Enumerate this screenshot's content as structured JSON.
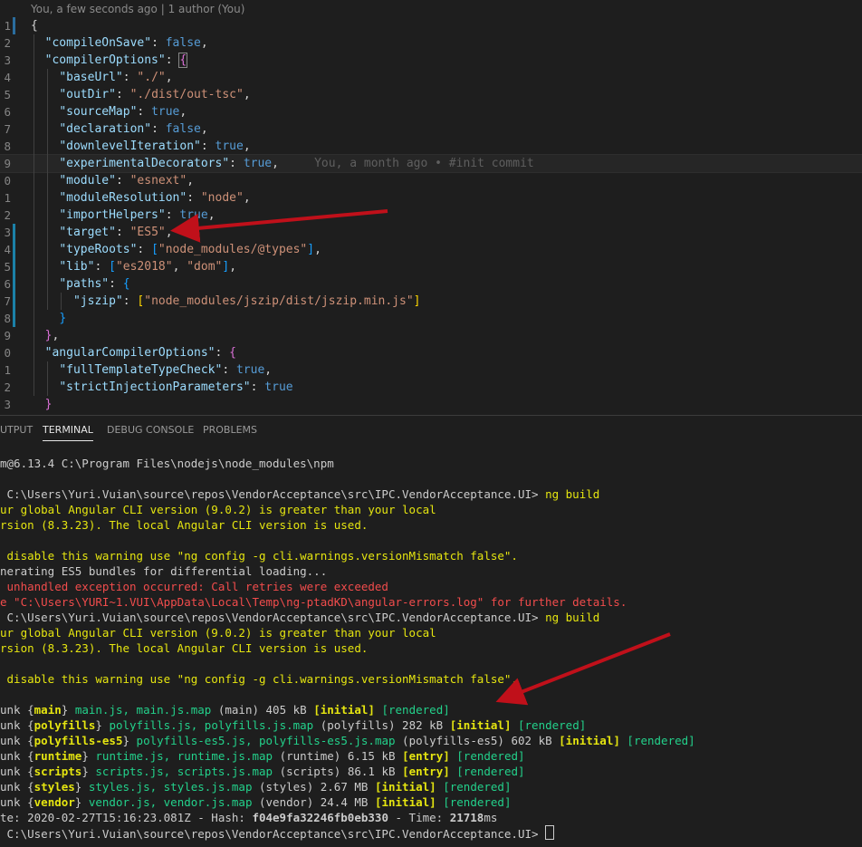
{
  "editor": {
    "blame_header": "You, a few seconds ago | 1 author (You)",
    "inline_blame": "You, a month ago • #init commit",
    "lines": [
      {
        "n": "1",
        "segs": [
          [
            "p",
            "{"
          ]
        ]
      },
      {
        "n": "2",
        "segs": [
          [
            "p",
            "  "
          ],
          [
            "k",
            "\"compileOnSave\""
          ],
          [
            "p",
            ": "
          ],
          [
            "b",
            "false"
          ],
          [
            "p",
            ","
          ]
        ]
      },
      {
        "n": "3",
        "segs": [
          [
            "p",
            "  "
          ],
          [
            "k",
            "\"compilerOptions\""
          ],
          [
            "p",
            ": "
          ],
          [
            "br2",
            "{"
          ]
        ]
      },
      {
        "n": "4",
        "segs": [
          [
            "p",
            "    "
          ],
          [
            "k",
            "\"baseUrl\""
          ],
          [
            "p",
            ": "
          ],
          [
            "s",
            "\"./\""
          ],
          [
            "p",
            ","
          ]
        ]
      },
      {
        "n": "5",
        "segs": [
          [
            "p",
            "    "
          ],
          [
            "k",
            "\"outDir\""
          ],
          [
            "p",
            ": "
          ],
          [
            "s",
            "\"./dist/out-tsc\""
          ],
          [
            "p",
            ","
          ]
        ]
      },
      {
        "n": "6",
        "segs": [
          [
            "p",
            "    "
          ],
          [
            "k",
            "\"sourceMap\""
          ],
          [
            "p",
            ": "
          ],
          [
            "b",
            "true"
          ],
          [
            "p",
            ","
          ]
        ]
      },
      {
        "n": "7",
        "segs": [
          [
            "p",
            "    "
          ],
          [
            "k",
            "\"declaration\""
          ],
          [
            "p",
            ": "
          ],
          [
            "b",
            "false"
          ],
          [
            "p",
            ","
          ]
        ]
      },
      {
        "n": "8",
        "segs": [
          [
            "p",
            "    "
          ],
          [
            "k",
            "\"downlevelIteration\""
          ],
          [
            "p",
            ": "
          ],
          [
            "b",
            "true"
          ],
          [
            "p",
            ","
          ]
        ]
      },
      {
        "n": "9",
        "segs": [
          [
            "p",
            "    "
          ],
          [
            "k",
            "\"experimentalDecorators\""
          ],
          [
            "p",
            ": "
          ],
          [
            "b",
            "true"
          ],
          [
            "p",
            ","
          ]
        ]
      },
      {
        "n": "0",
        "segs": [
          [
            "p",
            "    "
          ],
          [
            "k",
            "\"module\""
          ],
          [
            "p",
            ": "
          ],
          [
            "s",
            "\"esnext\""
          ],
          [
            "p",
            ","
          ]
        ]
      },
      {
        "n": "1",
        "segs": [
          [
            "p",
            "    "
          ],
          [
            "k",
            "\"moduleResolution\""
          ],
          [
            "p",
            ": "
          ],
          [
            "s",
            "\"node\""
          ],
          [
            "p",
            ","
          ]
        ]
      },
      {
        "n": "2",
        "segs": [
          [
            "p",
            "    "
          ],
          [
            "k",
            "\"importHelpers\""
          ],
          [
            "p",
            ": "
          ],
          [
            "b",
            "true"
          ],
          [
            "p",
            ","
          ]
        ]
      },
      {
        "n": "3",
        "segs": [
          [
            "p",
            "    "
          ],
          [
            "k",
            "\"target\""
          ],
          [
            "p",
            ": "
          ],
          [
            "s",
            "\"ES5\""
          ],
          [
            "p",
            ","
          ]
        ]
      },
      {
        "n": "4",
        "segs": [
          [
            "p",
            "    "
          ],
          [
            "k",
            "\"typeRoots\""
          ],
          [
            "p",
            ": "
          ],
          [
            "br3",
            "["
          ],
          [
            "s",
            "\"node_modules/@types\""
          ],
          [
            "br3",
            "]"
          ],
          [
            "p",
            ","
          ]
        ]
      },
      {
        "n": "5",
        "segs": [
          [
            "p",
            "    "
          ],
          [
            "k",
            "\"lib\""
          ],
          [
            "p",
            ": "
          ],
          [
            "br3",
            "["
          ],
          [
            "s",
            "\"es2018\""
          ],
          [
            "p",
            ", "
          ],
          [
            "s",
            "\"dom\""
          ],
          [
            "br3",
            "]"
          ],
          [
            "p",
            ","
          ]
        ]
      },
      {
        "n": "6",
        "segs": [
          [
            "p",
            "    "
          ],
          [
            "k",
            "\"paths\""
          ],
          [
            "p",
            ": "
          ],
          [
            "br3",
            "{"
          ]
        ]
      },
      {
        "n": "7",
        "segs": [
          [
            "p",
            "      "
          ],
          [
            "k",
            "\"jszip\""
          ],
          [
            "p",
            ": "
          ],
          [
            "br1",
            "["
          ],
          [
            "s",
            "\"node_modules/jszip/dist/jszip.min.js\""
          ],
          [
            "br1",
            "]"
          ]
        ]
      },
      {
        "n": "8",
        "segs": [
          [
            "p",
            "    "
          ],
          [
            "br3",
            "}"
          ]
        ]
      },
      {
        "n": "9",
        "segs": [
          [
            "p",
            "  "
          ],
          [
            "br2",
            "}"
          ],
          [
            "p",
            ","
          ]
        ]
      },
      {
        "n": "0",
        "segs": [
          [
            "p",
            "  "
          ],
          [
            "k",
            "\"angularCompilerOptions\""
          ],
          [
            "p",
            ": "
          ],
          [
            "br2",
            "{"
          ]
        ]
      },
      {
        "n": "1",
        "segs": [
          [
            "p",
            "    "
          ],
          [
            "k",
            "\"fullTemplateTypeCheck\""
          ],
          [
            "p",
            ": "
          ],
          [
            "b",
            "true"
          ],
          [
            "p",
            ","
          ]
        ]
      },
      {
        "n": "2",
        "segs": [
          [
            "p",
            "    "
          ],
          [
            "k",
            "\"strictInjectionParameters\""
          ],
          [
            "p",
            ": "
          ],
          [
            "b",
            "true"
          ]
        ]
      },
      {
        "n": "3",
        "segs": [
          [
            "p",
            "  "
          ],
          [
            "br2",
            "}"
          ]
        ]
      }
    ]
  },
  "panel": {
    "tabs": [
      "UTPUT",
      "TERMINAL",
      "DEBUG CONSOLE",
      "PROBLEMS"
    ],
    "active_tab": "TERMINAL",
    "terminal_lines": [
      [
        [
          "t-w",
          "m@6.13.4 C:\\Program Files\\nodejs\\node_modules\\npm"
        ]
      ],
      [
        [
          "t-w",
          ""
        ]
      ],
      [
        [
          "t-w",
          " C:\\Users\\Yuri.Vuian\\source\\repos\\VendorAcceptance\\src\\IPC.VendorAcceptance.UI> "
        ],
        [
          "t-y",
          "ng build"
        ]
      ],
      [
        [
          "t-y",
          "ur global Angular CLI version (9.0.2) is greater than your local"
        ]
      ],
      [
        [
          "t-y",
          "rsion (8.3.23). The local Angular CLI version is used."
        ]
      ],
      [
        [
          "t-w",
          ""
        ]
      ],
      [
        [
          "t-y",
          " disable this warning use \"ng config -g cli.warnings.versionMismatch false\"."
        ]
      ],
      [
        [
          "t-w",
          "nerating ES5 bundles for differential loading..."
        ]
      ],
      [
        [
          "t-r",
          " unhandled exception occurred: Call retries were exceeded"
        ]
      ],
      [
        [
          "t-r",
          "e \"C:\\Users\\YURI~1.VUI\\AppData\\Local\\Temp\\ng-ptadKD\\angular-errors.log\" for further details."
        ]
      ],
      [
        [
          "t-w",
          " C:\\Users\\Yuri.Vuian\\source\\repos\\VendorAcceptance\\src\\IPC.VendorAcceptance.UI> "
        ],
        [
          "t-y",
          "ng build"
        ]
      ],
      [
        [
          "t-y",
          "ur global Angular CLI version (9.0.2) is greater than your local"
        ]
      ],
      [
        [
          "t-y",
          "rsion (8.3.23). The local Angular CLI version is used."
        ]
      ],
      [
        [
          "t-w",
          ""
        ]
      ],
      [
        [
          "t-y",
          " disable this warning use \"ng config -g cli.warnings.versionMismatch false\"."
        ]
      ],
      [
        [
          "t-w",
          ""
        ]
      ],
      [
        [
          "t-w",
          "unk {"
        ],
        [
          "t-y t-bold",
          "main"
        ],
        [
          "t-w",
          "} "
        ],
        [
          "t-g",
          "main.js, main.js.map"
        ],
        [
          "t-w",
          " (main) 405 kB "
        ],
        [
          "t-y t-bold",
          "[initial]"
        ],
        [
          "t-w",
          " "
        ],
        [
          "t-g",
          "[rendered]"
        ]
      ],
      [
        [
          "t-w",
          "unk {"
        ],
        [
          "t-y t-bold",
          "polyfills"
        ],
        [
          "t-w",
          "} "
        ],
        [
          "t-g",
          "polyfills.js, polyfills.js.map"
        ],
        [
          "t-w",
          " (polyfills) 282 kB "
        ],
        [
          "t-y t-bold",
          "[initial]"
        ],
        [
          "t-w",
          " "
        ],
        [
          "t-g",
          "[rendered]"
        ]
      ],
      [
        [
          "t-w",
          "unk {"
        ],
        [
          "t-y t-bold",
          "polyfills-es5"
        ],
        [
          "t-w",
          "} "
        ],
        [
          "t-g",
          "polyfills-es5.js, polyfills-es5.js.map"
        ],
        [
          "t-w",
          " (polyfills-es5) 602 kB "
        ],
        [
          "t-y t-bold",
          "[initial]"
        ],
        [
          "t-w",
          " "
        ],
        [
          "t-g",
          "[rendered]"
        ]
      ],
      [
        [
          "t-w",
          "unk {"
        ],
        [
          "t-y t-bold",
          "runtime"
        ],
        [
          "t-w",
          "} "
        ],
        [
          "t-g",
          "runtime.js, runtime.js.map"
        ],
        [
          "t-w",
          " (runtime) 6.15 kB "
        ],
        [
          "t-y t-bold",
          "[entry]"
        ],
        [
          "t-w",
          " "
        ],
        [
          "t-g",
          "[rendered]"
        ]
      ],
      [
        [
          "t-w",
          "unk {"
        ],
        [
          "t-y t-bold",
          "scripts"
        ],
        [
          "t-w",
          "} "
        ],
        [
          "t-g",
          "scripts.js, scripts.js.map"
        ],
        [
          "t-w",
          " (scripts) 86.1 kB "
        ],
        [
          "t-y t-bold",
          "[entry]"
        ],
        [
          "t-w",
          " "
        ],
        [
          "t-g",
          "[rendered]"
        ]
      ],
      [
        [
          "t-w",
          "unk {"
        ],
        [
          "t-y t-bold",
          "styles"
        ],
        [
          "t-w",
          "} "
        ],
        [
          "t-g",
          "styles.js, styles.js.map"
        ],
        [
          "t-w",
          " (styles) 2.67 MB "
        ],
        [
          "t-y t-bold",
          "[initial]"
        ],
        [
          "t-w",
          " "
        ],
        [
          "t-g",
          "[rendered]"
        ]
      ],
      [
        [
          "t-w",
          "unk {"
        ],
        [
          "t-y t-bold",
          "vendor"
        ],
        [
          "t-w",
          "} "
        ],
        [
          "t-g",
          "vendor.js, vendor.js.map"
        ],
        [
          "t-w",
          " (vendor) 24.4 MB "
        ],
        [
          "t-y t-bold",
          "[initial]"
        ],
        [
          "t-w",
          " "
        ],
        [
          "t-g",
          "[rendered]"
        ]
      ],
      [
        [
          "t-w",
          "te: 2020-02-27T15:16:23.081Z - Hash: "
        ],
        [
          "t-w t-bold",
          "f04e9fa32246fb0eb330"
        ],
        [
          "t-w",
          " - Time: "
        ],
        [
          "t-w t-bold",
          "21718"
        ],
        [
          "t-w",
          "ms"
        ]
      ],
      [
        [
          "t-w",
          " C:\\Users\\Yuri.Vuian\\source\\repos\\VendorAcceptance\\src\\IPC.VendorAcceptance.UI> "
        ]
      ]
    ]
  },
  "colors": {
    "arrow": "#c0101a",
    "background": "#1e1e1e"
  }
}
